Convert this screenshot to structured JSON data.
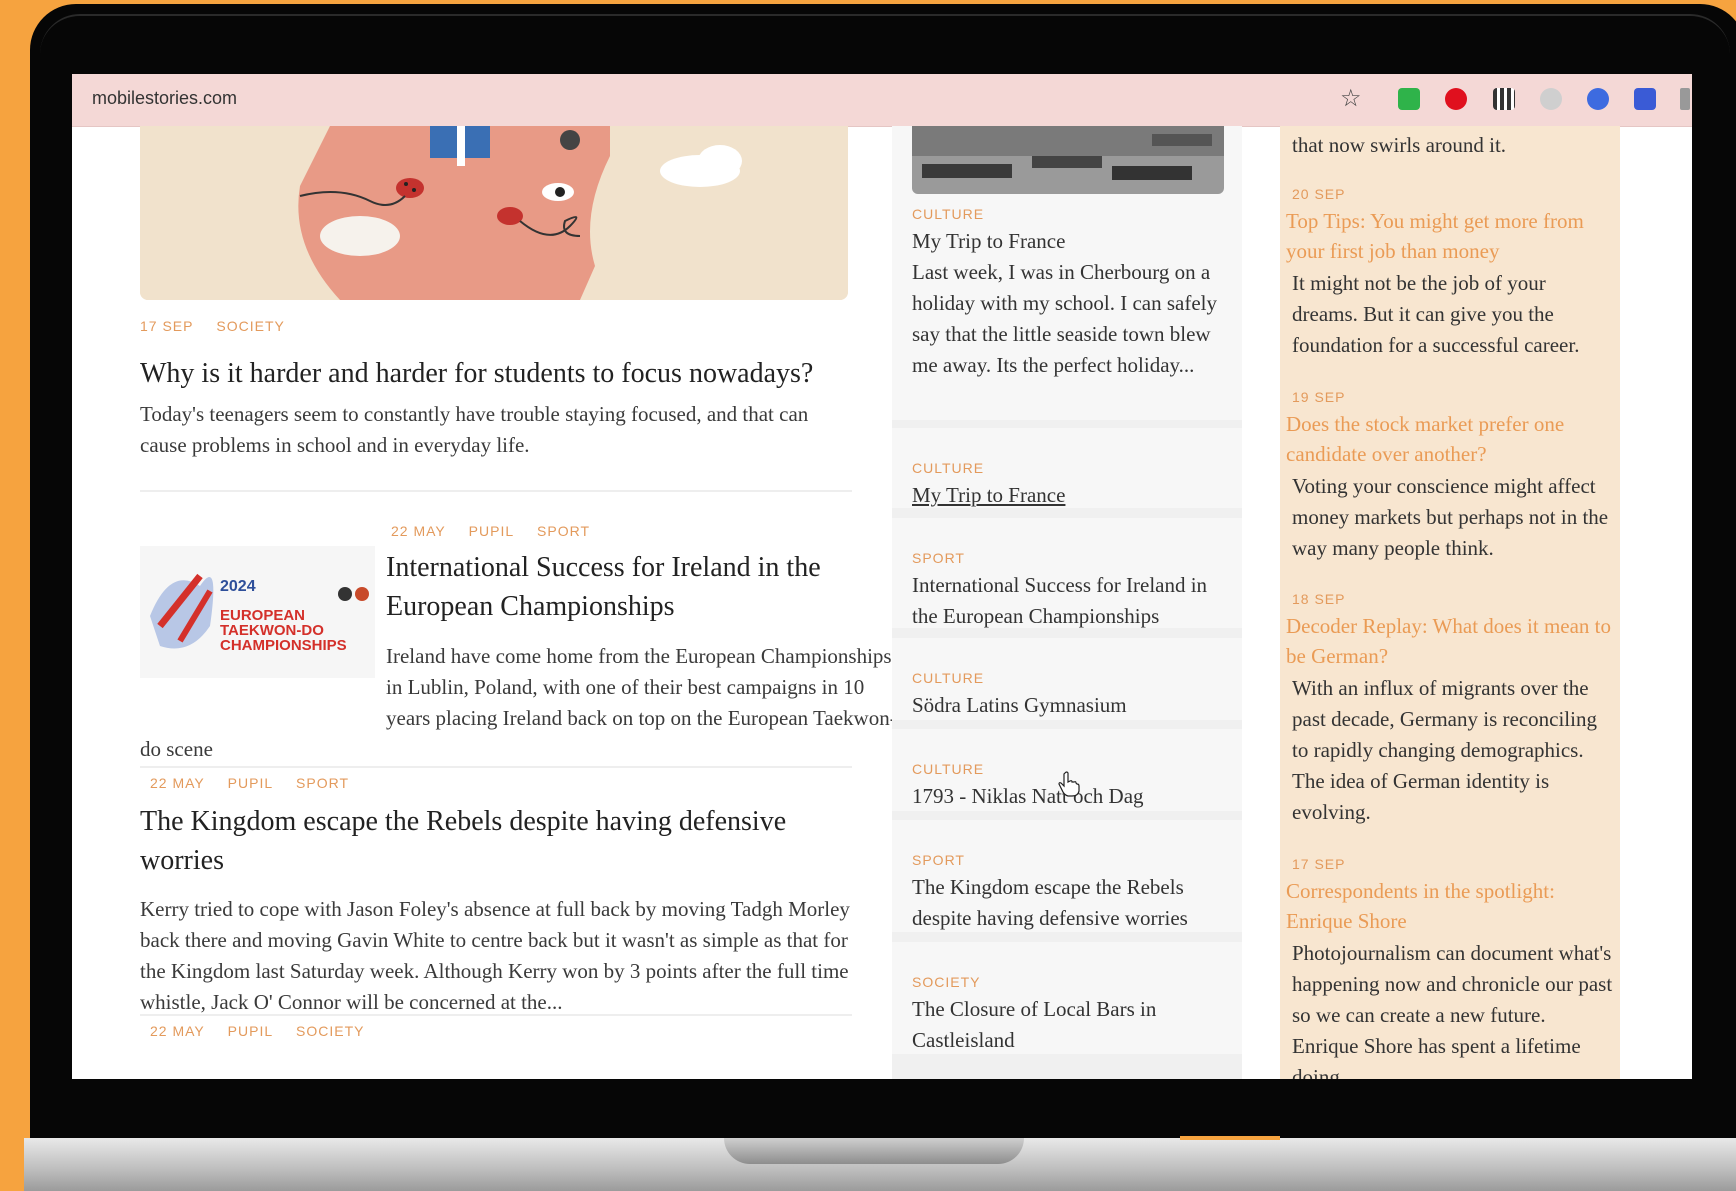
{
  "browser": {
    "url": "mobilestories.com",
    "bookmark_icon": "star-icon",
    "extensions": [
      "reader-extension-icon",
      "opera-icon",
      "qr-code-icon",
      "grammarly-icon",
      "zoom-icon",
      "apps-grid-icon"
    ]
  },
  "feed": {
    "article1": {
      "date": "17 SEP",
      "tags": [
        "SOCIETY"
      ],
      "title": "Why is it harder and harder for students to focus nowadays?",
      "excerpt": "Today's teenagers seem to constantly have trouble staying focused, and that can cause problems in school and in everyday life."
    },
    "article2": {
      "date": "22 MAY",
      "tags": [
        "PUPIL",
        "SPORT"
      ],
      "title": "International Success for Ireland in the European Championships",
      "excerpt": "Ireland have come home from the European Championships in Lublin, Poland, with one of their best campaigns in 10 years placing Ireland back on top on the European Taekwon-do scene",
      "thumb": {
        "year": "2024",
        "line1": "EUROPEAN",
        "line2": "TAEKWON-DO",
        "line3": "CHAMPIONSHIPS"
      }
    },
    "article3": {
      "date": "22 MAY",
      "tags": [
        "PUPIL",
        "SPORT"
      ],
      "title": "The Kingdom escape the Rebels despite having defensive worries",
      "excerpt": "Kerry tried to cope with Jason Foley's absence at full back by moving Tadgh Morley back there and moving Gavin White to centre back but it wasn't as simple as that for the Kingdom last Saturday week. Although Kerry won by 3 points after the full time whistle, Jack O' Connor will be concerned at the..."
    },
    "article4": {
      "date": "22 MAY",
      "tags": [
        "PUPIL",
        "SOCIETY"
      ]
    }
  },
  "middle": {
    "featured": {
      "category": "CULTURE",
      "title": "My Trip to France",
      "excerpt": "Last week, I was in Cherbourg on a holiday with my school. I can safely say that the little seaside town blew me away. Its the perfect holiday..."
    },
    "items": [
      {
        "category": "CULTURE",
        "title": "My Trip to France"
      },
      {
        "category": "SPORT",
        "title": "International Success for Ireland in the European Championships"
      },
      {
        "category": "CULTURE",
        "title": "Södra Latins Gymnasium"
      },
      {
        "category": "CULTURE",
        "title": "1793 - Niklas Natt och Dag"
      },
      {
        "category": "SPORT",
        "title": "The Kingdom escape the Rebels despite having defensive worries"
      },
      {
        "category": "SOCIETY",
        "title": "The Closure of Local Bars in Castleisland"
      }
    ]
  },
  "right": {
    "lead_text": "that now swirls around it.",
    "items": [
      {
        "date": "20 SEP",
        "title": "Top Tips: You might get more from your first job than money",
        "text": "It might not be the job of your dreams. But it can give you the foundation for a successful career."
      },
      {
        "date": "19 SEP",
        "title": "Does the stock market prefer one candidate over another?",
        "text": "Voting your conscience might affect money markets but perhaps not in the way many people think."
      },
      {
        "date": "18 SEP",
        "title": "Decoder Replay: What does it mean to be German?",
        "text": "With an influx of migrants over the past decade, Germany is reconciling to rapidly changing demographics. The idea of German identity is evolving."
      },
      {
        "date": "17 SEP",
        "title": "Correspondents in the spotlight: Enrique Shore",
        "text": "Photojournalism can document what's happening now and chronicle our past so we can create a new future. Enrique Shore has spent a lifetime doing"
      }
    ]
  },
  "colors": {
    "accent": "#e39a5c",
    "link_orange": "#ea9b55",
    "address_bar": "#f4d8d6",
    "right_panel": "#f8e6d0",
    "page_background": "#f6a33f"
  }
}
